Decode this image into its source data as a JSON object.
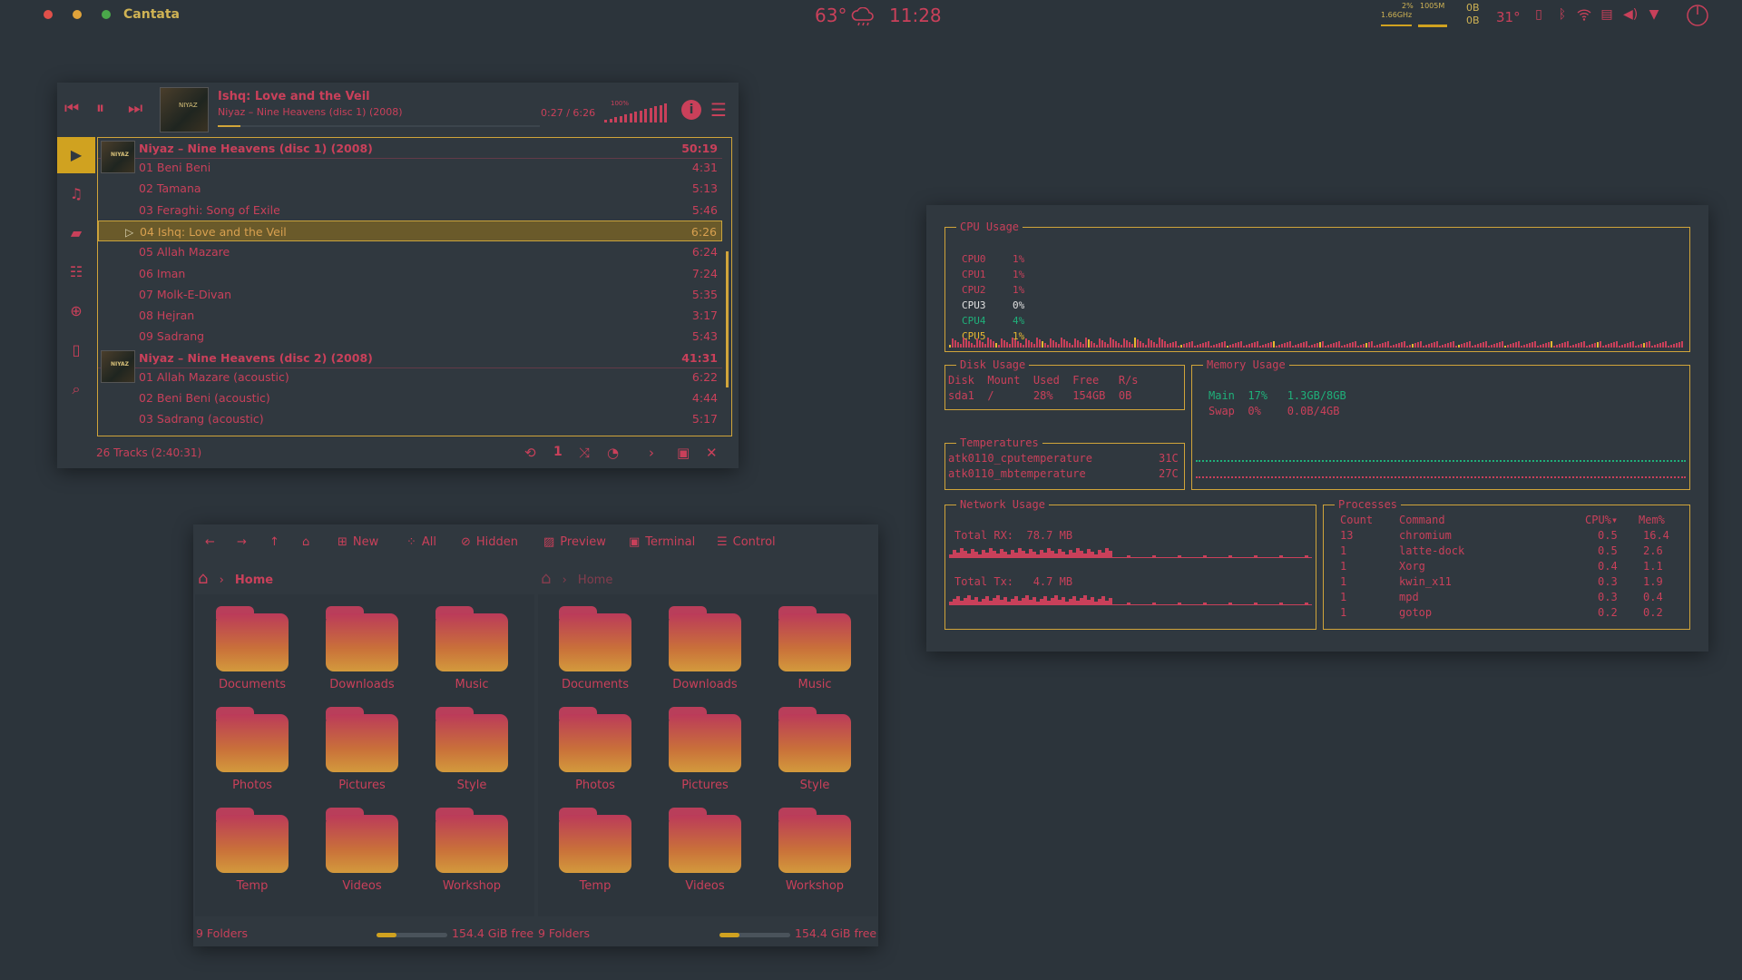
{
  "panel": {
    "app_name": "Cantata",
    "weather_temp": "63°",
    "clock": "11:28",
    "cpu_freq": "1.66GHz",
    "cpu_pct": "2%",
    "mem": "1005M",
    "net_up": "0B",
    "net_down": "0B",
    "sys_temp": "31°",
    "colors": {
      "close": "#e0504a",
      "minimize": "#e0a33a",
      "maximize": "#4aa84a"
    }
  },
  "cantata": {
    "now_playing": {
      "title": "Ishq: Love and the Veil",
      "album": "Niyaz – Nine Heavens (disc 1) (2008)",
      "time": "0:27 / 6:26",
      "progress": 0.07,
      "volume_label": "100%",
      "cover_text": "NIYAZ"
    },
    "sidebar": [
      "play-queue",
      "library",
      "folders",
      "playlists",
      "internet",
      "devices",
      "search"
    ],
    "playlist": [
      {
        "type": "header",
        "text": "Niyaz – Nine Heavens (disc 1) (2008)",
        "dur": "50:19"
      },
      {
        "type": "track",
        "text": "01 Beni Beni",
        "dur": "4:31"
      },
      {
        "type": "track",
        "text": "02 Tamana",
        "dur": "5:13"
      },
      {
        "type": "track",
        "text": "03 Feraghi: Song of Exile",
        "dur": "5:46"
      },
      {
        "type": "current",
        "text": "04 Ishq: Love and the Veil",
        "dur": "6:26"
      },
      {
        "type": "track",
        "text": "05 Allah Mazare",
        "dur": "6:24"
      },
      {
        "type": "track",
        "text": "06 Iman",
        "dur": "7:24"
      },
      {
        "type": "track",
        "text": "07 Molk-E-Divan",
        "dur": "5:35"
      },
      {
        "type": "track",
        "text": "08 Hejran",
        "dur": "3:17"
      },
      {
        "type": "track",
        "text": "09 Sadrang",
        "dur": "5:43"
      },
      {
        "type": "header",
        "text": "Niyaz – Nine Heavens (disc 2) (2008)",
        "dur": "41:31"
      },
      {
        "type": "track",
        "text": "01 Allah Mazare (acoustic)",
        "dur": "6:22"
      },
      {
        "type": "track",
        "text": "02 Beni Beni (acoustic)",
        "dur": "4:44"
      },
      {
        "type": "track",
        "text": "03 Sadrang (acoustic)",
        "dur": "5:17"
      }
    ],
    "status": "26 Tracks (2:40:31)",
    "single_label": "1"
  },
  "sysmon": {
    "cpu_title": "CPU Usage",
    "cpus": [
      {
        "name": "CPU0",
        "val": "1%",
        "color": "#c9405a"
      },
      {
        "name": "CPU1",
        "val": "1%",
        "color": "#c9405a"
      },
      {
        "name": "CPU2",
        "val": "1%",
        "color": "#c9405a"
      },
      {
        "name": "CPU3",
        "val": "0%",
        "color": "#e0e0e0"
      },
      {
        "name": "CPU4",
        "val": "4%",
        "color": "#1fb07a"
      },
      {
        "name": "CPU5",
        "val": "1%",
        "color": "#e8b830"
      }
    ],
    "disk_title": "Disk Usage",
    "disk_header": "Disk  Mount  Used  Free   R/s",
    "disk_row": "sda1  /      28%   154GB  0B",
    "mem_title": "Memory Usage",
    "mem_main": "Main  17%   1.3GB/8GB",
    "mem_swap": "Swap  0%    0.0B/4GB",
    "temp_title": "Temperatures",
    "temps": [
      {
        "name": "atk0110_cputemperature",
        "val": "31C"
      },
      {
        "name": "atk0110_mbtemperature",
        "val": "27C"
      }
    ],
    "net_title": "Network Usage",
    "net_rx": "Total RX:  78.7 MB",
    "net_tx": "Total Tx:   4.7 MB",
    "proc_title": "Processes",
    "proc_header": {
      "count": "Count",
      "command": "Command",
      "cpu": "CPU%▾",
      "mem": "Mem%"
    },
    "procs": [
      {
        "count": "13",
        "command": "chromium",
        "cpu": "0.5",
        "mem": "16.4"
      },
      {
        "count": "1",
        "command": "latte-dock",
        "cpu": "0.5",
        "mem": "2.6"
      },
      {
        "count": "1",
        "command": "Xorg",
        "cpu": "0.4",
        "mem": "1.1"
      },
      {
        "count": "1",
        "command": "kwin_x11",
        "cpu": "0.3",
        "mem": "1.9"
      },
      {
        "count": "1",
        "command": "mpd",
        "cpu": "0.3",
        "mem": "0.4"
      },
      {
        "count": "1",
        "command": "gotop",
        "cpu": "0.2",
        "mem": "0.2"
      }
    ]
  },
  "files": {
    "toolbar": {
      "new": "New",
      "all": "All",
      "hidden": "Hidden",
      "preview": "Preview",
      "terminal": "Terminal",
      "control": "Control"
    },
    "left_crumb": "Home",
    "right_crumb": "Home",
    "folders": [
      "Documents",
      "Downloads",
      "Music",
      "Photos",
      "Pictures",
      "Style",
      "Temp",
      "Videos",
      "Workshop"
    ],
    "status_count": "9 Folders",
    "status_free": "154.4 GiB free",
    "disk_used_fraction": 0.28
  }
}
